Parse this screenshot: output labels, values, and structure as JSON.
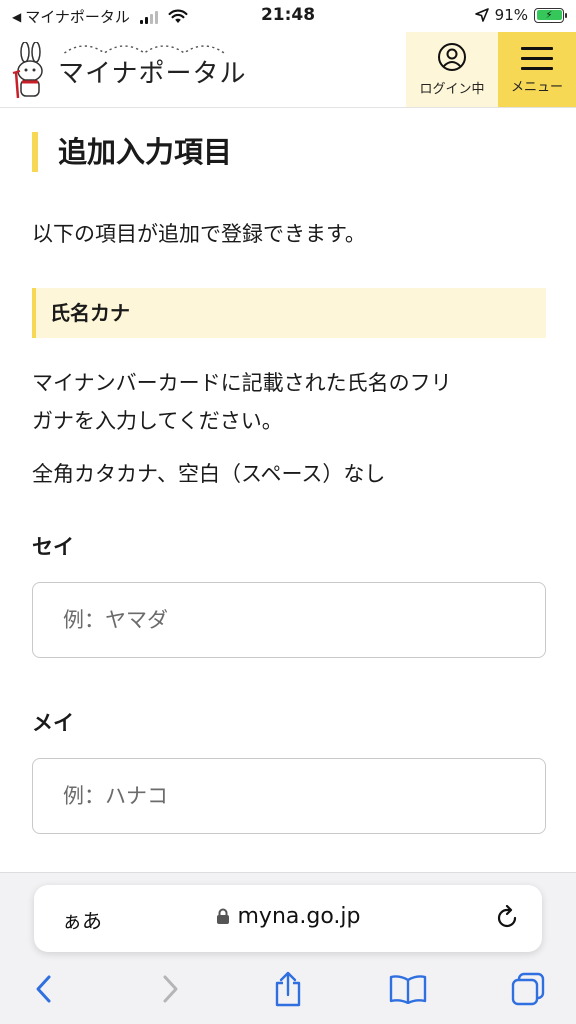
{
  "status_bar": {
    "back_app": "マイナポータル",
    "time": "21:48",
    "battery": "91%"
  },
  "header": {
    "logo_text": "マイナポータル",
    "login_label": "ログイン中",
    "menu_label": "メニュー"
  },
  "content": {
    "page_title": "追加入力項目",
    "intro": "以下の項目が追加で登録できます。",
    "section_title": "氏名カナ",
    "desc_line1": "マイナンバーカードに記載された氏名のフリ",
    "desc_line2": "ガナを入力してください。",
    "note": "全角カタカナ、空白（スペース）なし",
    "sei": {
      "label": "セイ",
      "placeholder": "例：ヤマダ",
      "value": ""
    },
    "mei": {
      "label": "メイ",
      "placeholder": "例：ハナコ",
      "value": ""
    }
  },
  "browser": {
    "aa_label": "ぁあ",
    "url": "myna.go.jp"
  },
  "icons": {
    "status": [
      "back-triangle-icon",
      "signal-icon",
      "wifi-icon",
      "location-arrow-icon",
      "battery-charging-icon"
    ],
    "header": [
      "mascot-logo-icon",
      "user-circle-icon",
      "hamburger-icon"
    ],
    "toolbar": [
      "back-icon",
      "forward-icon",
      "share-icon",
      "bookmarks-icon",
      "tabs-icon"
    ]
  },
  "colors": {
    "accent_yellow": "#f6d855",
    "light_yellow": "#fdf6d8",
    "text": "#1a1a1a",
    "ios_blue": "#2f6fe0"
  }
}
